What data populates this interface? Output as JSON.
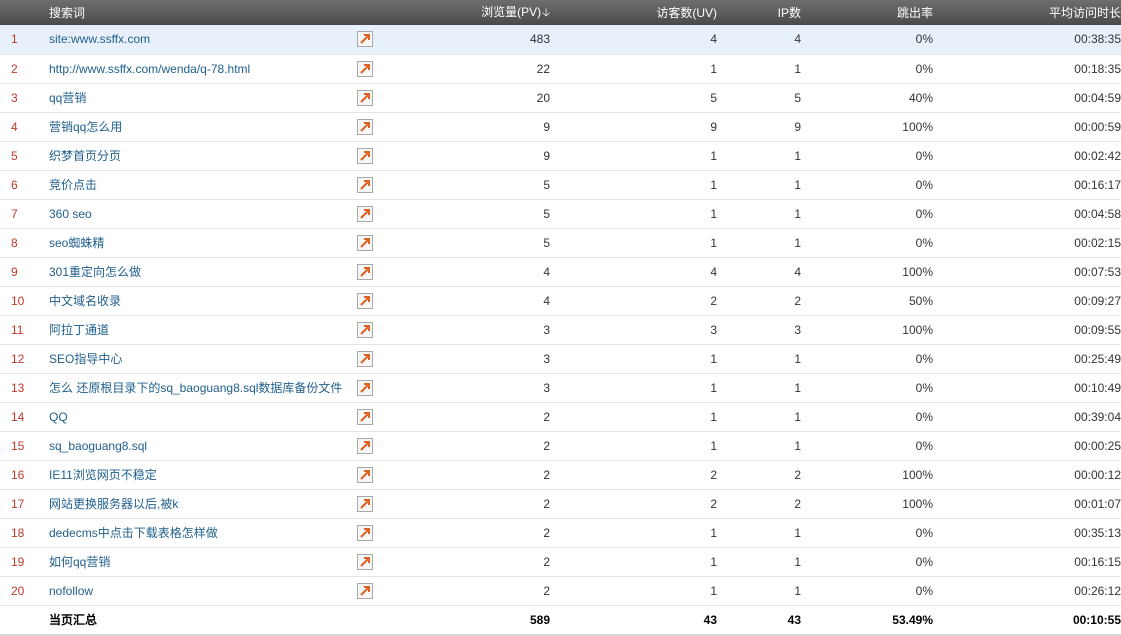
{
  "header": {
    "keyword": "搜索词",
    "pv": "浏览量(PV)",
    "uv": "访客数(UV)",
    "ip": "IP数",
    "bounce": "跳出率",
    "avg_time": "平均访问时长",
    "sort_icon": "arrow-down-icon"
  },
  "rows": [
    {
      "idx": "1",
      "kw": "site:www.ssffx.com",
      "pv": "483",
      "uv": "4",
      "ip": "4",
      "bounce": "0%",
      "time": "00:38:35"
    },
    {
      "idx": "2",
      "kw": "http://www.ssffx.com/wenda/q-78.html",
      "pv": "22",
      "uv": "1",
      "ip": "1",
      "bounce": "0%",
      "time": "00:18:35"
    },
    {
      "idx": "3",
      "kw": "qq营销",
      "pv": "20",
      "uv": "5",
      "ip": "5",
      "bounce": "40%",
      "time": "00:04:59"
    },
    {
      "idx": "4",
      "kw": "营销qq怎么用",
      "pv": "9",
      "uv": "9",
      "ip": "9",
      "bounce": "100%",
      "time": "00:00:59"
    },
    {
      "idx": "5",
      "kw": "织梦首页分页",
      "pv": "9",
      "uv": "1",
      "ip": "1",
      "bounce": "0%",
      "time": "00:02:42"
    },
    {
      "idx": "6",
      "kw": "竞价点击",
      "pv": "5",
      "uv": "1",
      "ip": "1",
      "bounce": "0%",
      "time": "00:16:17"
    },
    {
      "idx": "7",
      "kw": "360 seo",
      "pv": "5",
      "uv": "1",
      "ip": "1",
      "bounce": "0%",
      "time": "00:04:58"
    },
    {
      "idx": "8",
      "kw": "seo蜘蛛精",
      "pv": "5",
      "uv": "1",
      "ip": "1",
      "bounce": "0%",
      "time": "00:02:15"
    },
    {
      "idx": "9",
      "kw": "301重定向怎么做",
      "pv": "4",
      "uv": "4",
      "ip": "4",
      "bounce": "100%",
      "time": "00:07:53"
    },
    {
      "idx": "10",
      "kw": "中文域名收录",
      "pv": "4",
      "uv": "2",
      "ip": "2",
      "bounce": "50%",
      "time": "00:09:27"
    },
    {
      "idx": "11",
      "kw": "阿拉丁通道",
      "pv": "3",
      "uv": "3",
      "ip": "3",
      "bounce": "100%",
      "time": "00:09:55"
    },
    {
      "idx": "12",
      "kw": "SEO指导中心",
      "pv": "3",
      "uv": "1",
      "ip": "1",
      "bounce": "0%",
      "time": "00:25:49"
    },
    {
      "idx": "13",
      "kw": "怎么 还原根目录下的sq_baoguang8.sql数据库备份文件",
      "pv": "3",
      "uv": "1",
      "ip": "1",
      "bounce": "0%",
      "time": "00:10:49"
    },
    {
      "idx": "14",
      "kw": "QQ",
      "pv": "2",
      "uv": "1",
      "ip": "1",
      "bounce": "0%",
      "time": "00:39:04"
    },
    {
      "idx": "15",
      "kw": "sq_baoguang8.sql",
      "pv": "2",
      "uv": "1",
      "ip": "1",
      "bounce": "0%",
      "time": "00:00:25"
    },
    {
      "idx": "16",
      "kw": "IE11浏览网页不稳定",
      "pv": "2",
      "uv": "2",
      "ip": "2",
      "bounce": "100%",
      "time": "00:00:12"
    },
    {
      "idx": "17",
      "kw": "网站更换服务器以后,被k",
      "pv": "2",
      "uv": "2",
      "ip": "2",
      "bounce": "100%",
      "time": "00:01:07"
    },
    {
      "idx": "18",
      "kw": "dedecms中点击下载表格怎样做",
      "pv": "2",
      "uv": "1",
      "ip": "1",
      "bounce": "0%",
      "time": "00:35:13"
    },
    {
      "idx": "19",
      "kw": "如何qq营销",
      "pv": "2",
      "uv": "1",
      "ip": "1",
      "bounce": "0%",
      "time": "00:16:15"
    },
    {
      "idx": "20",
      "kw": "nofollow",
      "pv": "2",
      "uv": "1",
      "ip": "1",
      "bounce": "0%",
      "time": "00:26:12"
    }
  ],
  "total": {
    "label": "当页汇总",
    "pv": "589",
    "uv": "43",
    "ip": "43",
    "bounce": "53.49%",
    "time": "00:10:55"
  },
  "colors": {
    "header_bg": "#5a5a5a",
    "link": "#1f5f8b",
    "index": "#c0392b",
    "selected_row": "#e8f1fb",
    "open_link_icon": "#e06020"
  },
  "row_icon": "open-external-link-icon"
}
